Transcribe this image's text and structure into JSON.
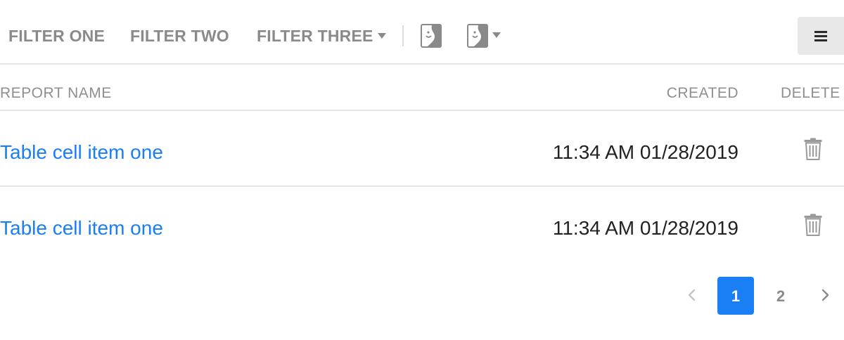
{
  "toolbar": {
    "filters": [
      {
        "label": "FILTER ONE"
      },
      {
        "label": "FILTER TWO"
      },
      {
        "label": "FILTER THREE",
        "has_dropdown": true
      }
    ],
    "image_buttons": [
      {
        "icon": "image-icon"
      },
      {
        "icon": "image-icon",
        "has_dropdown": true
      }
    ],
    "menu_icon": "hamburger-menu-icon"
  },
  "table": {
    "columns": [
      "REPORT NAME",
      "CREATED",
      "DELETE"
    ],
    "rows": [
      {
        "name": "Table cell item one",
        "created": "11:34 AM 01/28/2019",
        "delete_icon": "trash-icon"
      },
      {
        "name": "Table cell item one",
        "created": "11:34 AM 01/28/2019",
        "delete_icon": "trash-icon"
      }
    ]
  },
  "pagination": {
    "pages": [
      "1",
      "2"
    ],
    "current_page": "1",
    "prev_icon": "chevron-left-icon",
    "next_icon": "chevron-right-icon"
  },
  "colors": {
    "accent": "#1a7ef5",
    "muted_text": "#8a8a8a",
    "divider": "#e6e6e6",
    "menu_button_bg": "#e8e8e8"
  }
}
